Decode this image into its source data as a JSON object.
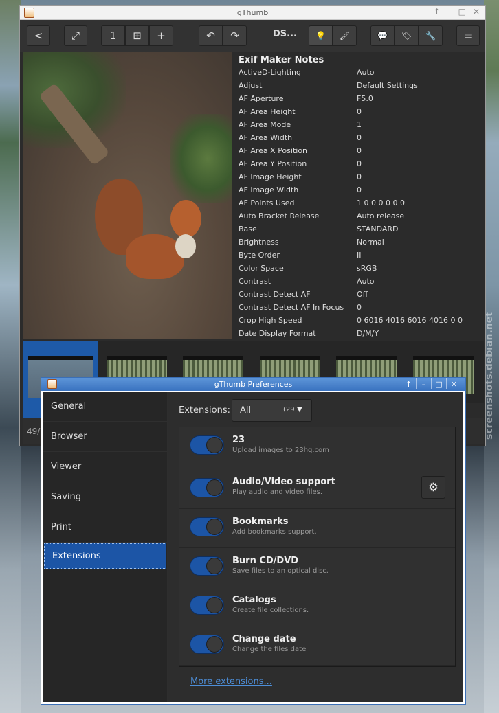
{
  "main_window": {
    "title": "gThumb",
    "toolbar": {
      "back": "<",
      "fullscreen": "⤢",
      "view1": "1",
      "view_fit": "⊞",
      "zoom_in": "+",
      "rotate_left": "↶",
      "rotate_right": "↷",
      "filename": "DS...",
      "bulb": "💡",
      "brush": "🖌",
      "comment": "💬",
      "tag": "🏷",
      "wrench": "🔧",
      "menu": "≡"
    },
    "exif_section_title": "Exif Maker Notes",
    "exif_rows": [
      {
        "key": "ActiveD-Lighting",
        "value": "Auto"
      },
      {
        "key": "Adjust",
        "value": "Default Settings"
      },
      {
        "key": "AF Aperture",
        "value": "F5.0"
      },
      {
        "key": "AF Area Height",
        "value": "0"
      },
      {
        "key": "AF Area Mode",
        "value": "1"
      },
      {
        "key": "AF Area Width",
        "value": "0"
      },
      {
        "key": "AF Area X Position",
        "value": "0"
      },
      {
        "key": "AF Area Y Position",
        "value": "0"
      },
      {
        "key": "AF Image Height",
        "value": "0"
      },
      {
        "key": "AF Image Width",
        "value": "0"
      },
      {
        "key": "AF Points Used",
        "value": "1 0 0 0 0 0 0"
      },
      {
        "key": "Auto Bracket Release",
        "value": "Auto release"
      },
      {
        "key": "Base",
        "value": "STANDARD"
      },
      {
        "key": "Brightness",
        "value": "Normal"
      },
      {
        "key": "Byte Order",
        "value": "II"
      },
      {
        "key": "Color Space",
        "value": "sRGB"
      },
      {
        "key": "Contrast",
        "value": "Auto"
      },
      {
        "key": "Contrast Detect AF",
        "value": "Off"
      },
      {
        "key": "Contrast Detect AF In Focus",
        "value": "0"
      },
      {
        "key": "Crop High Speed",
        "value": "0 6016 4016 6016 4016 0 0"
      },
      {
        "key": "Date Display Format",
        "value": "D/M/Y"
      }
    ],
    "status_text": "49/"
  },
  "prefs": {
    "title": "gThumb Preferences",
    "sidebar": [
      {
        "label": "General"
      },
      {
        "label": "Browser"
      },
      {
        "label": "Viewer"
      },
      {
        "label": "Saving"
      },
      {
        "label": "Print"
      },
      {
        "label": "Extensions"
      }
    ],
    "extensions_label": "Extensions:",
    "filter_value": "All",
    "filter_count": "(29",
    "extensions": [
      {
        "name": "23",
        "desc": "Upload images to 23hq.com"
      },
      {
        "name": "Audio/Video support",
        "desc": "Play audio and video files."
      },
      {
        "name": "Bookmarks",
        "desc": "Add bookmarks support."
      },
      {
        "name": "Burn CD/DVD",
        "desc": "Save files to an optical disc."
      },
      {
        "name": "Catalogs",
        "desc": "Create file collections."
      },
      {
        "name": "Change date",
        "desc": "Change the files date"
      }
    ],
    "more_link": "More extensions..."
  },
  "watermark": "screenshots.debian.net",
  "colors": {
    "accent": "#1c55a6",
    "link": "#4d8ed8",
    "title_blue": "#3a73c0"
  }
}
